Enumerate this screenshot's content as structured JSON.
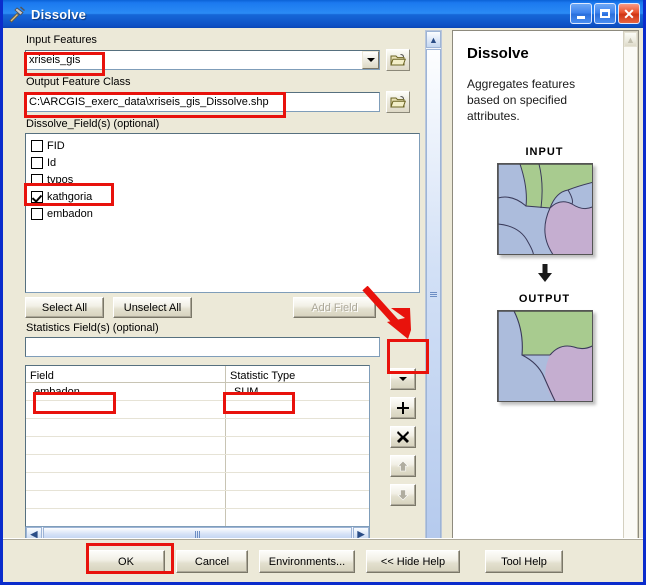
{
  "window": {
    "title": "Dissolve",
    "icon": "hammer-tool-icon",
    "minimize_label": "Minimize",
    "maximize_label": "Maximize",
    "close_label": "Close",
    "accent_title_color": "#1b79ef",
    "dialog_face_color": "#ece9d8",
    "annotation_color": "#e8120c"
  },
  "form": {
    "input_features": {
      "label": "Input Features",
      "value": "xriseis_gis",
      "browse_icon": "open-folder-icon",
      "dropdown_icon": "chevron-down-icon"
    },
    "output_feature_class": {
      "label": "Output Feature Class",
      "value": "C:\\ARCGIS_exerc_data\\xriseis_gis_Dissolve.shp",
      "browse_icon": "open-folder-icon"
    },
    "dissolve_fields": {
      "label": "Dissolve_Field(s) (optional)",
      "items": [
        {
          "label": "FID",
          "checked": false
        },
        {
          "label": "Id",
          "checked": false
        },
        {
          "label": "typos",
          "checked": false
        },
        {
          "label": "kathgoria",
          "checked": true
        },
        {
          "label": "embadon",
          "checked": false
        }
      ]
    },
    "list_actions": {
      "select_all": "Select All",
      "unselect_all": "Unselect All",
      "add_field": "Add Field",
      "add_field_enabled": false
    },
    "statistics_fields": {
      "label": "Statistics Field(s) (optional)",
      "value": "",
      "placeholder": ""
    },
    "statistics_grid": {
      "columns": [
        "Field",
        "Statistic Type"
      ],
      "rows": [
        {
          "field": "embadon",
          "statistic_type": "SUM"
        },
        {
          "field": "",
          "statistic_type": ""
        },
        {
          "field": "",
          "statistic_type": ""
        },
        {
          "field": "",
          "statistic_type": ""
        },
        {
          "field": "",
          "statistic_type": ""
        },
        {
          "field": "",
          "statistic_type": ""
        },
        {
          "field": "",
          "statistic_type": ""
        },
        {
          "field": "",
          "statistic_type": ""
        }
      ]
    },
    "grid_buttons": [
      {
        "name": "dropdown-button",
        "icon": "chevron-down-icon",
        "enabled": true
      },
      {
        "name": "add-row-button",
        "icon": "plus-icon",
        "enabled": true
      },
      {
        "name": "delete-row-button",
        "icon": "cross-icon",
        "enabled": true
      },
      {
        "name": "move-up-button",
        "icon": "arrow-up-icon",
        "enabled": false
      },
      {
        "name": "move-down-button",
        "icon": "arrow-down-icon",
        "enabled": false
      }
    ],
    "scrollbars": {
      "grid_left_arrow": "◀",
      "grid_right_arrow": "▶",
      "pane_up_arrow": "▲",
      "pane_down_arrow": "▼"
    }
  },
  "help": {
    "title": "Dissolve",
    "description": "Aggregates features based on specified attributes.",
    "input_label": "INPUT",
    "output_label": "OUTPUT",
    "flow_icon": "down-arrow-icon",
    "swatch_green": "#a8cb8f",
    "swatch_blue": "#acbcdc",
    "swatch_purple": "#c5aed0"
  },
  "footer": {
    "buttons": [
      {
        "label": "OK",
        "name": "ok-button"
      },
      {
        "label": "Cancel",
        "name": "cancel-button"
      },
      {
        "label": "Environments...",
        "name": "environments-button"
      },
      {
        "label": "<< Hide Help",
        "name": "hide-help-button"
      },
      {
        "label": "Tool Help",
        "name": "tool-help-button"
      }
    ]
  },
  "annotations": {
    "highlight_input_features": "red-box-input-features",
    "highlight_output_path": "red-box-output-path",
    "highlight_kathgoria": "red-box-kathgoria-checkbox",
    "highlight_dropdown": "red-box-dropdown-button",
    "highlight_embadon_cell": "red-box-embadon-cell",
    "highlight_sum_cell": "red-box-sum-cell",
    "highlight_ok": "red-box-ok-button",
    "arrow": "red-arrow-pointing-to-dropdown"
  }
}
